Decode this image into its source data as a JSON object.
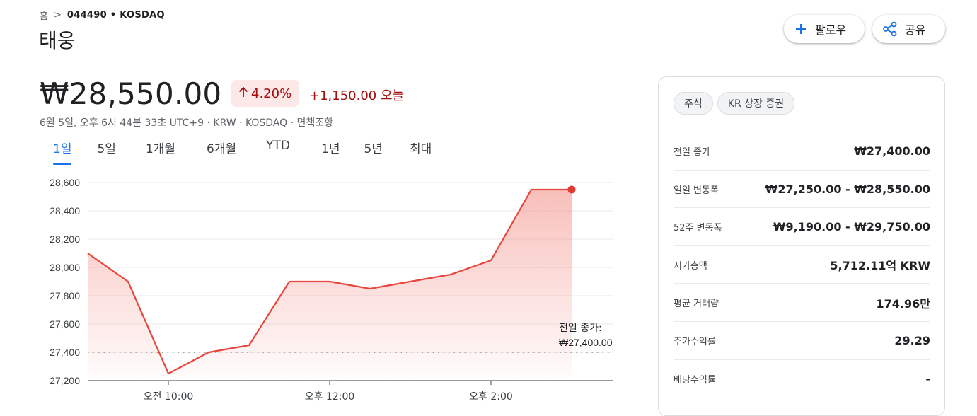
{
  "breadcrumb": {
    "home": "홈",
    "separator": ">",
    "ticker": "044490 • KOSDAQ"
  },
  "page_title": "태웅",
  "buttons": {
    "follow": "팔로우",
    "share": "공유"
  },
  "quote": {
    "price": "₩28,550.00",
    "change_pct": "4.20%",
    "change_abs": "+1,150.00",
    "change_period": "오늘",
    "meta": "6월 5일, 오후 6시 44분 33초 UTC+9 · KRW · KOSDAQ · 면책조항"
  },
  "tabs": [
    "1일",
    "5일",
    "1개월",
    "6개월",
    "YTD",
    "1년",
    "5년",
    "최대"
  ],
  "active_tab": "1일",
  "chart_data": {
    "type": "area",
    "x": [
      "09:00",
      "09:30",
      "10:00",
      "10:30",
      "11:00",
      "11:30",
      "12:00",
      "12:30",
      "13:00",
      "13:30",
      "14:00",
      "14:30",
      "15:00"
    ],
    "series": [
      {
        "values": [
          28100,
          27900,
          27250,
          27400,
          27450,
          27900,
          27900,
          27850,
          27900,
          27950,
          28050,
          28550,
          28550
        ]
      }
    ],
    "y_ticks": [
      "28,600",
      "28,400",
      "28,200",
      "28,000",
      "27,800",
      "27,600",
      "27,400",
      "27,200"
    ],
    "y_tick_values": [
      28600,
      28400,
      28200,
      28000,
      27800,
      27600,
      27400,
      27200
    ],
    "ylim": [
      27200,
      28600
    ],
    "x_ticks": [
      "오전 10:00",
      "오후 12:00",
      "오후 2:00"
    ],
    "x_tick_positions": [
      2,
      6,
      10
    ],
    "baseline": {
      "value": 27400,
      "label": "전일 종가:",
      "value_label": "₩27,400.00"
    },
    "colors": {
      "line": "#e8453c",
      "fill": "#f28b82",
      "grid": "#e8eaed",
      "axis": "#5f6368"
    }
  },
  "stats": {
    "chips": [
      "주식",
      "KR 상장 증권"
    ],
    "rows": [
      {
        "label": "전일 종가",
        "value": "₩27,400.00"
      },
      {
        "label": "일일 변동폭",
        "value": "₩27,250.00 - ₩28,550.00"
      },
      {
        "label": "52주 변동폭",
        "value": "₩9,190.00 - ₩29,750.00"
      },
      {
        "label": "시가총액",
        "value": "5,712.11억 KRW"
      },
      {
        "label": "평균 거래량",
        "value": "174.96만"
      },
      {
        "label": "주가수익률",
        "value": "29.29"
      },
      {
        "label": "배당수익률",
        "value": "-"
      }
    ]
  }
}
